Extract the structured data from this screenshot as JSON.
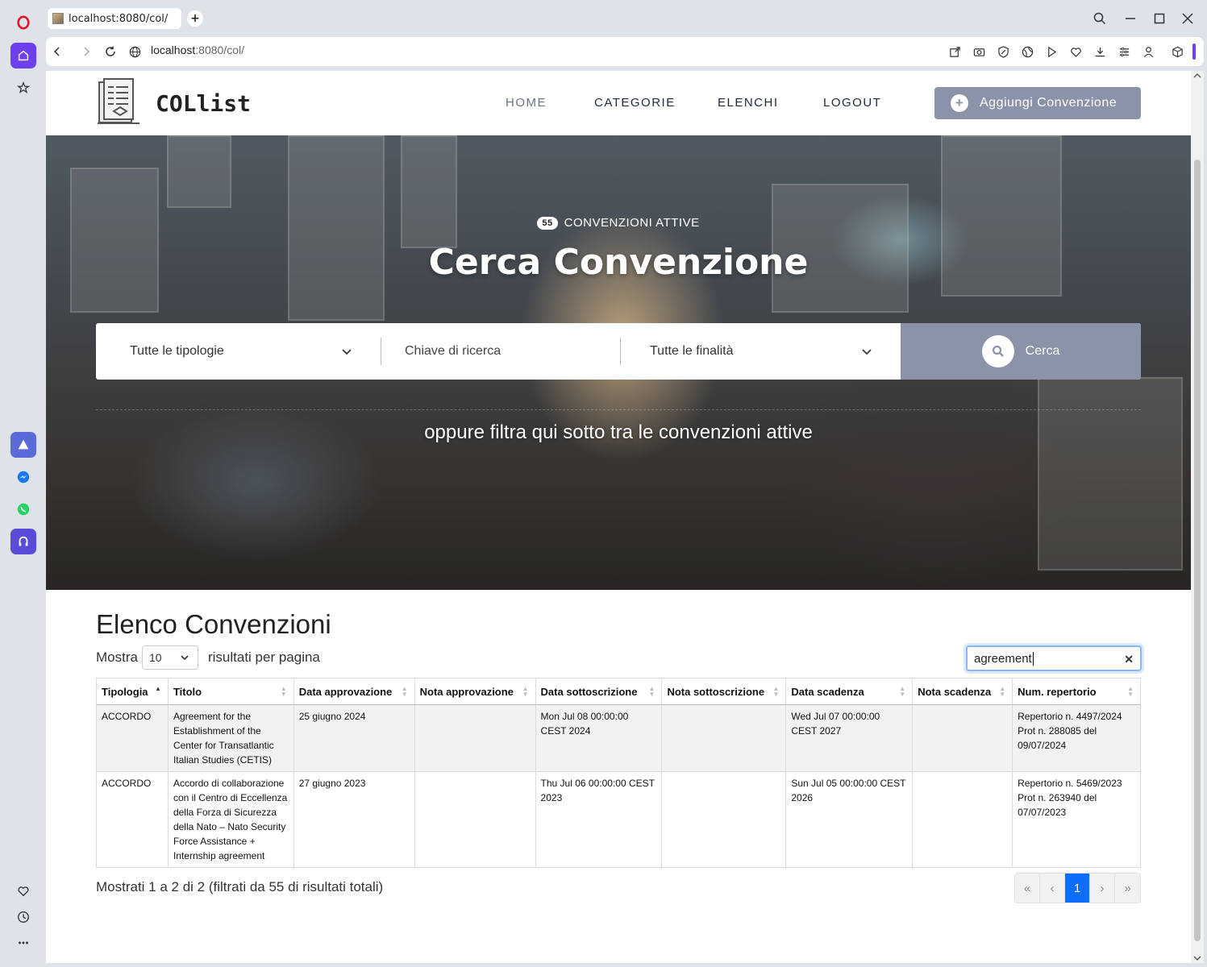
{
  "browser": {
    "tab_title": "localhost:8080/col/",
    "url_host": "localhost",
    "url_rest": ":8080/col/"
  },
  "header": {
    "site_name": "COLlist",
    "nav": [
      "HOME",
      "CATEGORIE",
      "ELENCHI",
      "LOGOUT"
    ],
    "add_button": "Aggiungi Convenzione"
  },
  "hero": {
    "active_count": "55",
    "active_label": "CONVENZIONI ATTIVE",
    "title": "Cerca Convenzione",
    "type_select": "Tutte le tipologie",
    "keyword_placeholder": "Chiave di ricerca",
    "purpose_select": "Tutte le finalità",
    "search_button": "Cerca",
    "subtitle": "oppure filtra qui sotto tra le convenzioni attive"
  },
  "listing": {
    "title": "Elenco Convenzioni",
    "show_prefix": "Mostra",
    "per_page": "10",
    "show_suffix": "risultati per pagina",
    "filter_value": "agreement",
    "columns": [
      "Tipologia",
      "Titolo",
      "Data approvazione",
      "Nota approvazione",
      "Data sottoscrizione",
      "Nota sottoscrizione",
      "Data scadenza",
      "Nota scadenza",
      "Num. repertorio"
    ],
    "rows": [
      [
        "ACCORDO",
        "Agreement for the Establishment of the Center for Transatlantic Italian Studies (CETIS)",
        "25 giugno 2024",
        "",
        "Mon Jul 08 00:00:00 CEST 2024",
        "",
        "Wed Jul 07 00:00:00 CEST 2027",
        "",
        "Repertorio n. 4497/2024 Prot n. 288085 del 09/07/2024"
      ],
      [
        "ACCORDO",
        "Accordo di collaborazione con il Centro di Eccellenza della Forza di Sicurezza della Nato – Nato Security Force Assistance + Internship agreement",
        "27 giugno 2023",
        "",
        "Thu Jul 06 00:00:00 CEST 2023",
        "",
        "Sun Jul 05 00:00:00 CEST 2026",
        "",
        "Repertorio n. 5469/2023 Prot n. 263940 del 07/07/2023"
      ]
    ],
    "info": "Mostrati 1 a 2 di 2 (filtrati da 55 di risultati totali)",
    "pager": [
      "«",
      "‹",
      "1",
      "›",
      "»"
    ]
  }
}
